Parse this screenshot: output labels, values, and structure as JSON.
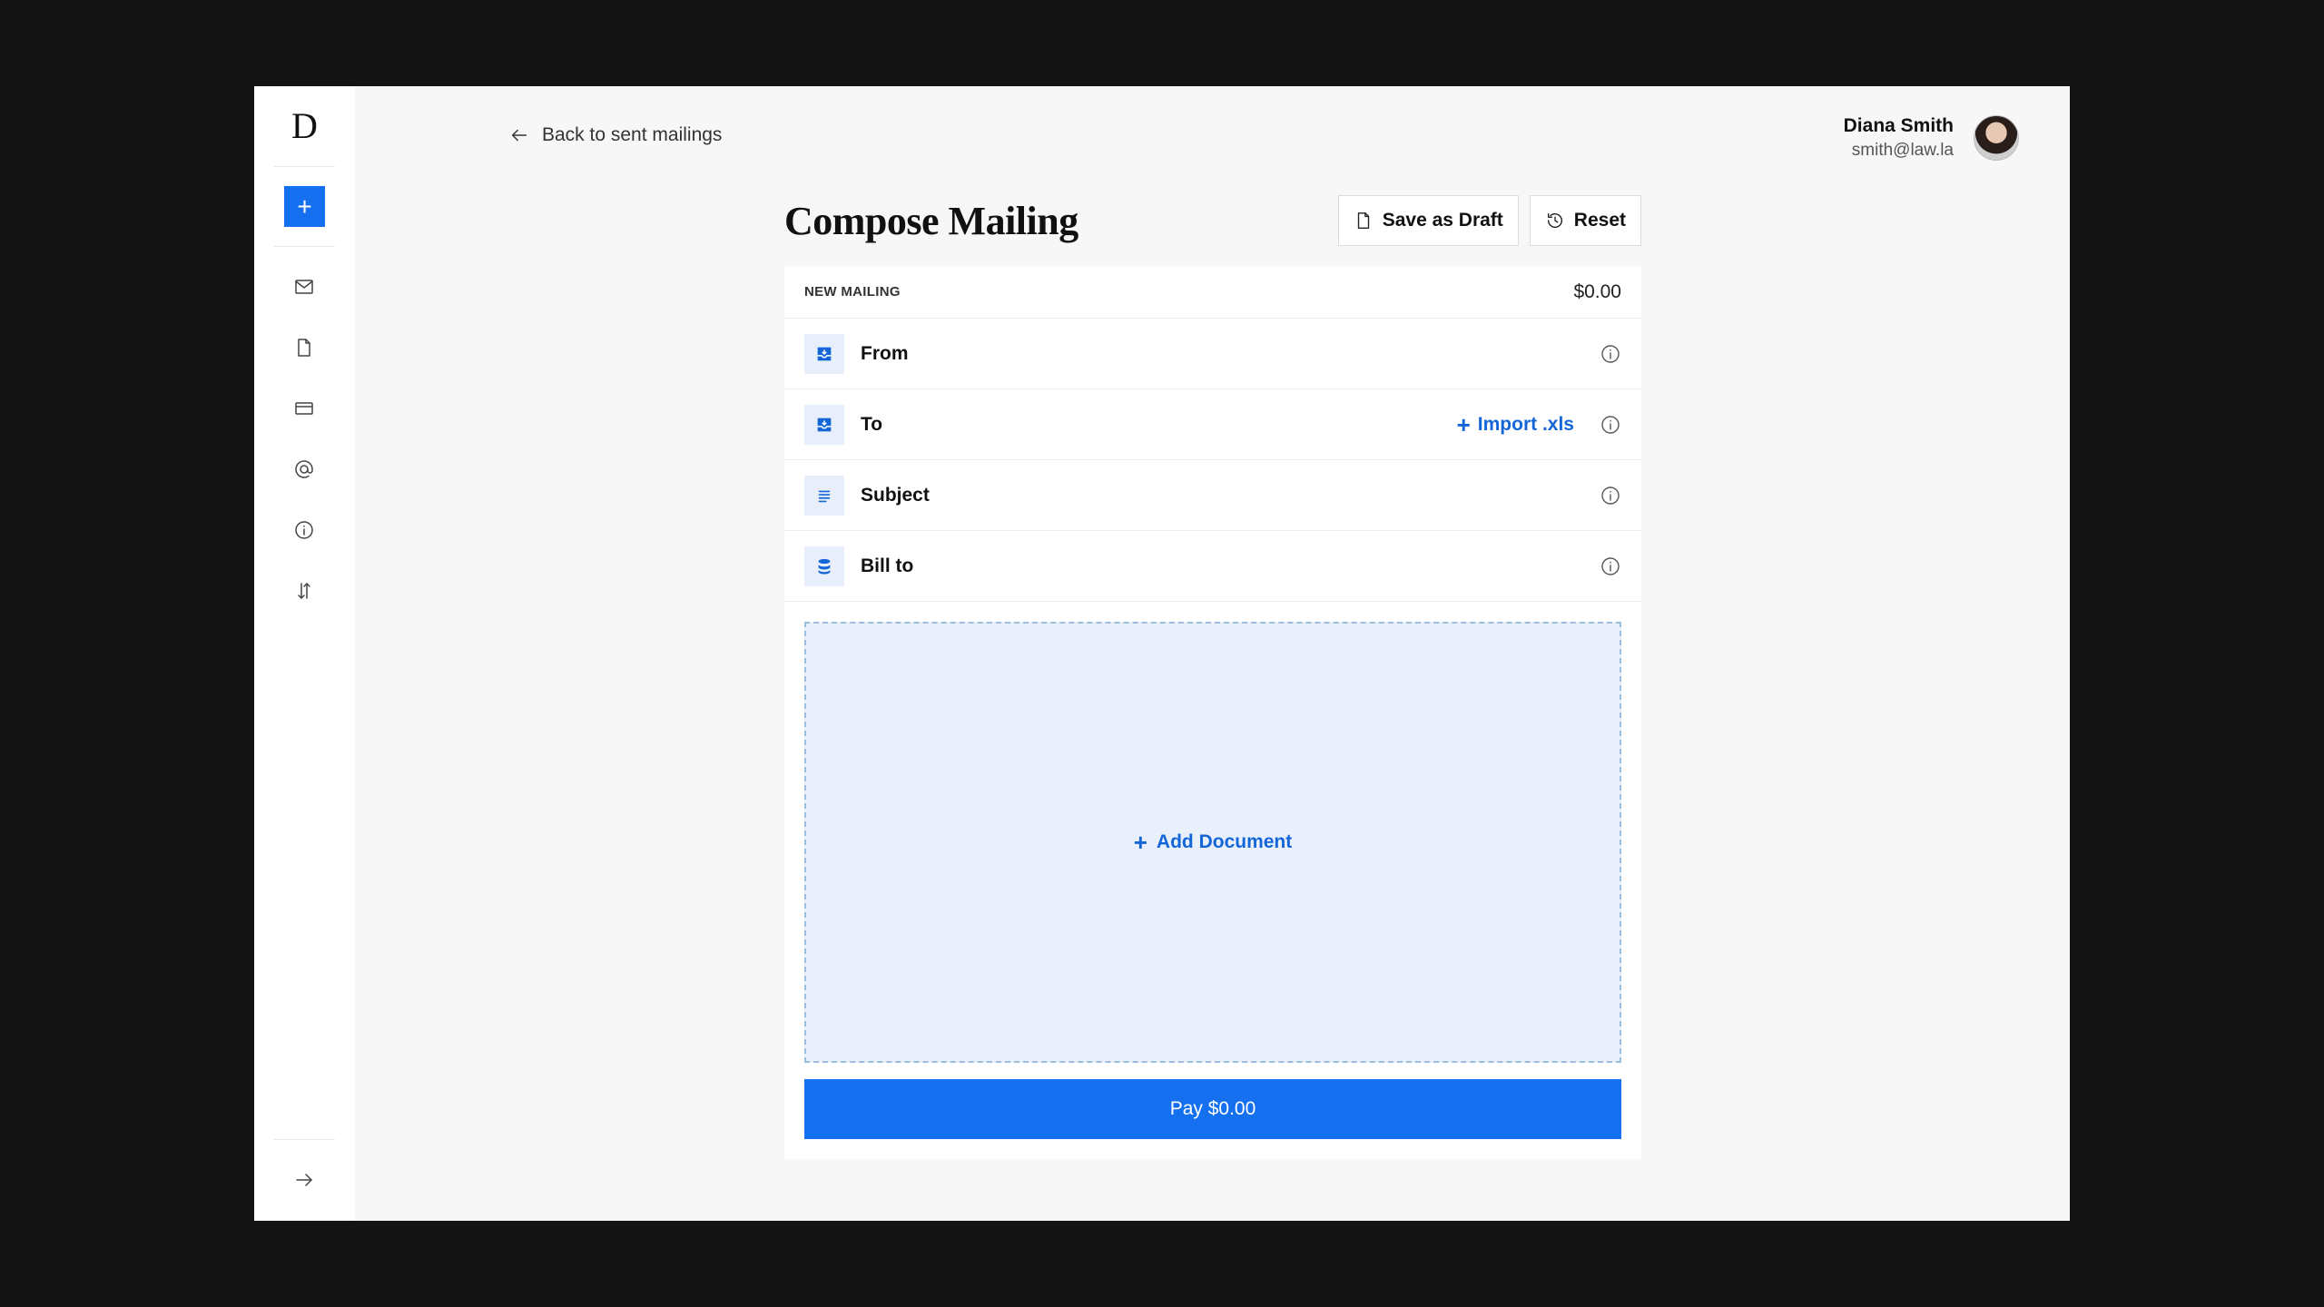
{
  "sidebar": {
    "logo": "D",
    "new_button_symbol": "+",
    "nav_icons": [
      "mail-icon",
      "document-icon",
      "credit-card-icon",
      "at-sign-icon",
      "info-icon",
      "sliders-icon"
    ],
    "collapse_icon": "arrow-right-icon"
  },
  "header": {
    "back_link": "Back to sent mailings",
    "user": {
      "name": "Diana Smith",
      "email": "smith@law.la"
    }
  },
  "compose": {
    "title": "Compose Mailing",
    "save_draft_label": "Save as Draft",
    "reset_label": "Reset",
    "card_label": "NEW MAILING",
    "total": "$0.00",
    "fields": [
      {
        "label": "From",
        "icon": "inbox-icon"
      },
      {
        "label": "To",
        "icon": "inbox-icon"
      },
      {
        "label": "Subject",
        "icon": "text-lines-icon"
      },
      {
        "label": "Bill to",
        "icon": "database-icon"
      }
    ],
    "import_label": "Import .xls",
    "add_document_label": "Add Document",
    "pay_label": "Pay $0.00"
  },
  "colors": {
    "accent": "#1570f0",
    "link": "#1466d8",
    "field_icon_bg": "#e8effa",
    "dropzone_bg": "#e9f0fc",
    "background": "#141414"
  }
}
